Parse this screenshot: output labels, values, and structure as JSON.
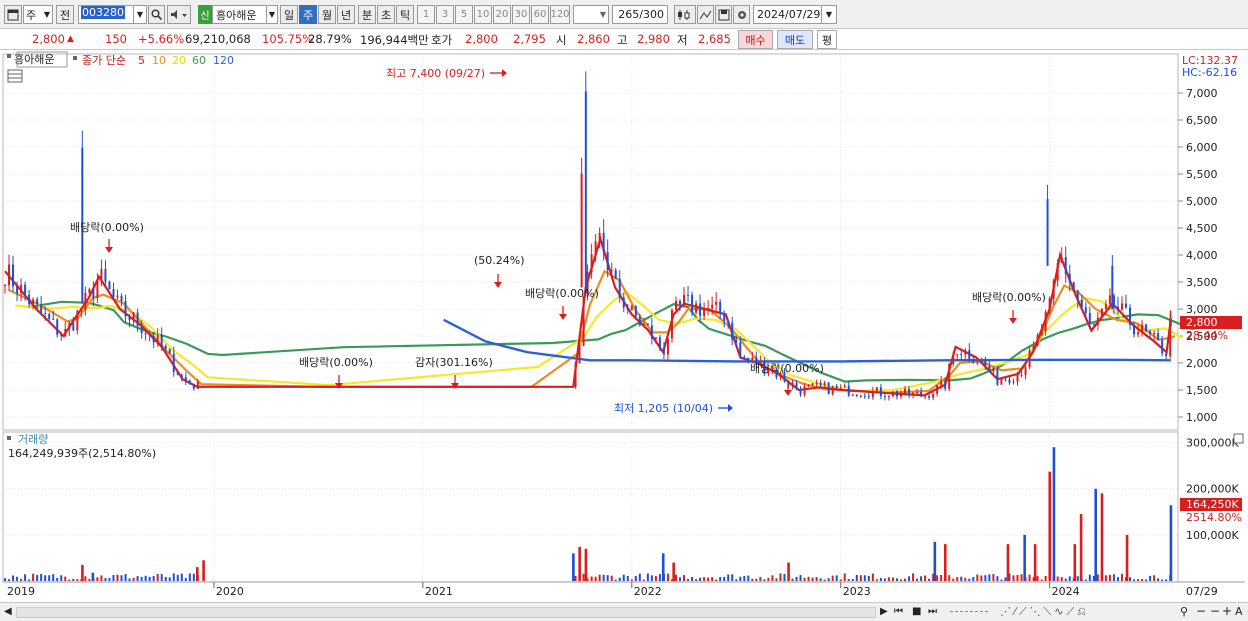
{
  "toolbar": {
    "market_select": "주",
    "prev_label": "전",
    "stock_code": "003280",
    "credit_badge": "신",
    "stock_name": "흥아해운",
    "periods": [
      "일",
      "주",
      "월",
      "년",
      "분",
      "초",
      "틱"
    ],
    "selected_period": "주",
    "intervals": [
      "1",
      "3",
      "5",
      "10",
      "20",
      "30",
      "60",
      "120"
    ],
    "count_display": "265",
    "count_total": "/300",
    "date": "2024/07/29"
  },
  "quote": {
    "price": "2,800",
    "change": "150",
    "change_pct": "+5.66%",
    "volume": "69,210,068",
    "volume_ratio": "105.75%",
    "turnover": "28.79%",
    "amount": "196,944백만",
    "hoga_label": "호가",
    "ask": "2,800",
    "bid": "2,795",
    "open_label": "시",
    "open": "2,860",
    "high_label": "고",
    "high": "2,980",
    "low_label": "저",
    "low": "2,685",
    "buy_label": "매수",
    "sell_label": "매도",
    "avg_label": "평"
  },
  "price_panel": {
    "legend_name": "흥아해운",
    "legend_ma": "종가 단순",
    "ma_periods": [
      "5",
      "10",
      "20",
      "60",
      "120"
    ],
    "ma_colors": [
      "#d81e1e",
      "#f08c1e",
      "#f5e82a",
      "#3a9a5a",
      "#2f5fd6"
    ],
    "lc": "LC:132.37",
    "hc": "HC:-62.16",
    "y_ticks": [
      "7,000",
      "6,500",
      "6,000",
      "5,500",
      "5,000",
      "4,500",
      "4,000",
      "3,500",
      "3,000",
      "2,500",
      "2,000",
      "1,500",
      "1,000"
    ],
    "current_price_tag": "2,800",
    "current_pct_tag": "28.44%",
    "annotations": {
      "high": "최고 7,400 (09/27)",
      "low": "최저 1,205 (10/04)",
      "div1": "배당락(0.00%)",
      "div2": "배당락(0.00%)",
      "capred": "감자(301.16%)",
      "split": "(50.24%)",
      "div3": "배당락(0.00%)",
      "div4": "배당락(0.00%)",
      "div5": "배당락(0.00%)"
    }
  },
  "volume_panel": {
    "title": "거래량",
    "value": "164,249,939주(2,514.80%)",
    "y_ticks": [
      "300,000K",
      "200,000K",
      "100,000K"
    ],
    "current_tag": "164,250K",
    "current_pct": "2514.80%"
  },
  "x_axis": {
    "labels": [
      "2019",
      "2020",
      "2021",
      "2022",
      "2023",
      "2024",
      "07/29"
    ]
  },
  "chart_data": {
    "type": "candlestick",
    "title": "",
    "price_ylim": [
      1000,
      7500
    ],
    "volume_ylim": [
      0,
      310000
    ],
    "ma5": [
      [
        2019.0,
        3700
      ],
      [
        2019.15,
        3000
      ],
      [
        2019.28,
        2500
      ],
      [
        2019.33,
        2800
      ],
      [
        2019.4,
        3200
      ],
      [
        2019.45,
        3600
      ],
      [
        2019.55,
        3000
      ],
      [
        2019.65,
        2700
      ],
      [
        2019.75,
        2300
      ],
      [
        2019.85,
        1700
      ],
      [
        2019.92,
        1560
      ],
      [
        2020.5,
        1560
      ],
      [
        2021.5,
        1560
      ],
      [
        2021.72,
        1560
      ],
      [
        2021.78,
        3400
      ],
      [
        2021.85,
        4300
      ],
      [
        2021.92,
        3400
      ],
      [
        2022.0,
        2900
      ],
      [
        2022.08,
        2600
      ],
      [
        2022.15,
        2200
      ],
      [
        2022.2,
        2900
      ],
      [
        2022.25,
        3100
      ],
      [
        2022.35,
        3000
      ],
      [
        2022.45,
        2900
      ],
      [
        2022.52,
        2100
      ],
      [
        2022.6,
        2000
      ],
      [
        2022.7,
        1800
      ],
      [
        2022.8,
        1500
      ],
      [
        2022.9,
        1550
      ],
      [
        2023.0,
        1500
      ],
      [
        2023.2,
        1450
      ],
      [
        2023.4,
        1400
      ],
      [
        2023.5,
        1600
      ],
      [
        2023.55,
        2300
      ],
      [
        2023.65,
        2100
      ],
      [
        2023.75,
        1700
      ],
      [
        2023.85,
        1800
      ],
      [
        2023.92,
        2200
      ],
      [
        2024.0,
        3000
      ],
      [
        2024.05,
        4000
      ],
      [
        2024.12,
        3300
      ],
      [
        2024.2,
        2600
      ],
      [
        2024.3,
        3100
      ],
      [
        2024.4,
        2700
      ],
      [
        2024.5,
        2400
      ],
      [
        2024.56,
        2200
      ],
      [
        2024.58,
        2800
      ]
    ],
    "ma120": [
      [
        2021.1,
        2800
      ],
      [
        2021.3,
        2400
      ],
      [
        2021.5,
        2200
      ],
      [
        2021.8,
        2050
      ],
      [
        2022.0,
        2050
      ],
      [
        2022.5,
        2030
      ],
      [
        2023.0,
        2030
      ],
      [
        2023.5,
        2050
      ],
      [
        2024.0,
        2060
      ],
      [
        2024.3,
        2060
      ],
      [
        2024.58,
        2050
      ]
    ],
    "volume_peaks": [
      [
        2019.37,
        35000
      ],
      [
        2019.42,
        18000
      ],
      [
        2019.92,
        30000
      ],
      [
        2019.95,
        45000
      ],
      [
        2021.72,
        60000
      ],
      [
        2021.75,
        74000
      ],
      [
        2021.78,
        70000
      ],
      [
        2022.15,
        60000
      ],
      [
        2022.2,
        40000
      ],
      [
        2022.75,
        40000
      ],
      [
        2023.45,
        85000
      ],
      [
        2023.5,
        80000
      ],
      [
        2023.8,
        80000
      ],
      [
        2023.88,
        100000
      ],
      [
        2023.93,
        80000
      ],
      [
        2024.0,
        237000
      ],
      [
        2024.02,
        290000
      ],
      [
        2024.12,
        80000
      ],
      [
        2024.15,
        145000
      ],
      [
        2024.22,
        200000
      ],
      [
        2024.25,
        190000
      ],
      [
        2024.37,
        100000
      ],
      [
        2024.58,
        164250
      ]
    ]
  }
}
